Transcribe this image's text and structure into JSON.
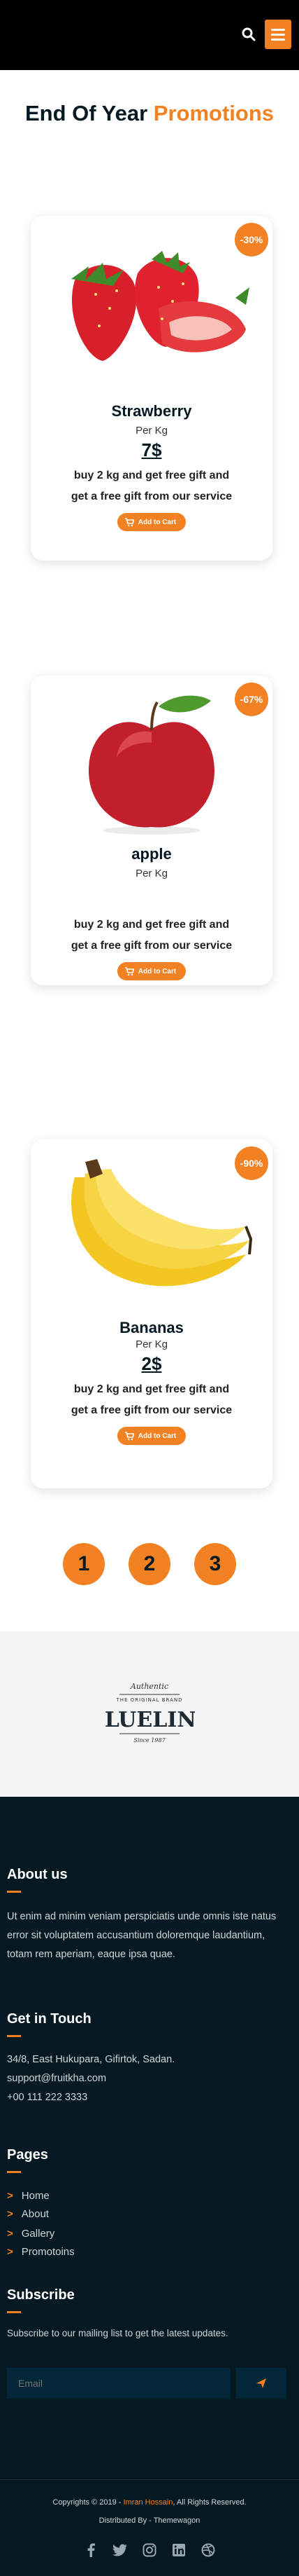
{
  "header": {
    "search_icon": "search-icon",
    "menu_icon": "hamburger-icon"
  },
  "section": {
    "title_main": "End Of Year",
    "title_accent": "Promotions"
  },
  "colors": {
    "accent": "#f28123",
    "dark": "#051922"
  },
  "products": [
    {
      "badge": "-30%",
      "name": "Strawberry",
      "unit": "Per Kg",
      "price": "7$",
      "desc_line1": "buy 2 kg and get free gift and",
      "desc_line2": "get a free gift from our service",
      "button": "Add to Cart"
    },
    {
      "badge": "-67%",
      "name": "apple",
      "unit": "Per Kg",
      "price": "",
      "desc_line1": "buy 2 kg and get free gift and",
      "desc_line2": "get a free gift from our service",
      "button": "Add to Cart"
    },
    {
      "badge": "-90%",
      "name": "Bananas",
      "unit": "Per Kg",
      "price": "2$",
      "desc_line1": "buy 2 kg and get free gift and",
      "desc_line2": "get a free gift from our service",
      "button": "Add to Cart"
    }
  ],
  "pagination": [
    "1",
    "2",
    "3"
  ],
  "brand": {
    "top": "Authentic",
    "sub": "THE ORIGINAL BRAND",
    "name": "BLUELINE",
    "since": "Since 1987"
  },
  "footer": {
    "about": {
      "title": "About us",
      "text": "Ut enim ad minim veniam perspiciatis unde omnis iste natus error sit voluptatem accusantium doloremque laudantium, totam rem aperiam,  eaque ipsa quae."
    },
    "contact": {
      "title": "Get in Touch",
      "address": "34/8, East Hukupara, Gifirtok, Sadan.",
      "email": "support@fruitkha.com",
      "phone": "+00 111 222 3333"
    },
    "pages": {
      "title": "Pages",
      "items": [
        "Home",
        "About",
        "Gallery",
        "Promotoins"
      ]
    },
    "subscribe": {
      "title": "Subscribe",
      "text": "Subscribe to our mailing list to get the  latest updates.",
      "placeholder": "Email"
    },
    "copyright": {
      "prefix": "Copyrights © 2019 -",
      "author": "Imran Hossain",
      "suffix": ",  All Rights Reserved.",
      "distributed": "Distributed By - Themewagon"
    },
    "socials": [
      "facebook-icon",
      "twitter-icon",
      "instagram-icon",
      "linkedin-icon",
      "dribbble-icon"
    ]
  }
}
